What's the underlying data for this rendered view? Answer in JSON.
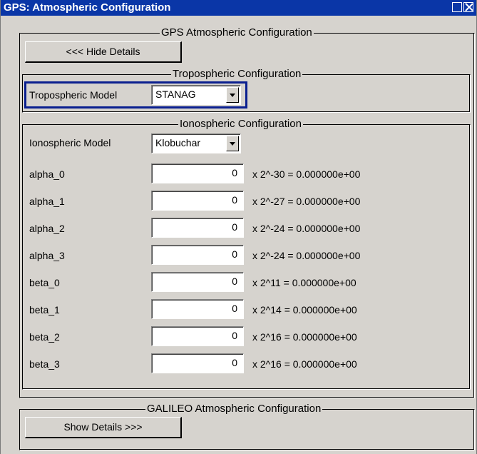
{
  "window": {
    "title": "GPS: Atmospheric Configuration"
  },
  "gps_group": {
    "legend": "GPS Atmospheric Configuration",
    "hide_details_label": "<<< Hide Details"
  },
  "tropo": {
    "legend": "Tropospheric Configuration",
    "model_label": "Tropospheric Model",
    "model_value": "STANAG"
  },
  "iono": {
    "legend": "Ionospheric Configuration",
    "model_label": "Ionospheric Model",
    "model_value": "Klobuchar",
    "params": [
      {
        "label": "alpha_0",
        "value": "0",
        "factor": "x  2^-30  =  0.000000e+00"
      },
      {
        "label": "alpha_1",
        "value": "0",
        "factor": "x  2^-27  =  0.000000e+00"
      },
      {
        "label": "alpha_2",
        "value": "0",
        "factor": "x  2^-24  =  0.000000e+00"
      },
      {
        "label": "alpha_3",
        "value": "0",
        "factor": "x  2^-24  =  0.000000e+00"
      },
      {
        "label": "beta_0",
        "value": "0",
        "factor": "x  2^11  =  0.000000e+00"
      },
      {
        "label": "beta_1",
        "value": "0",
        "factor": "x  2^14  =  0.000000e+00"
      },
      {
        "label": "beta_2",
        "value": "0",
        "factor": "x  2^16  =  0.000000e+00"
      },
      {
        "label": "beta_3",
        "value": "0",
        "factor": "x  2^16  =  0.000000e+00"
      }
    ]
  },
  "galileo_group": {
    "legend": "GALILEO Atmospheric Configuration",
    "show_details_label": "Show Details >>>"
  },
  "icons": {
    "restore": "restore-icon",
    "close": "close-icon",
    "dropdown": "chevron-down-icon"
  }
}
